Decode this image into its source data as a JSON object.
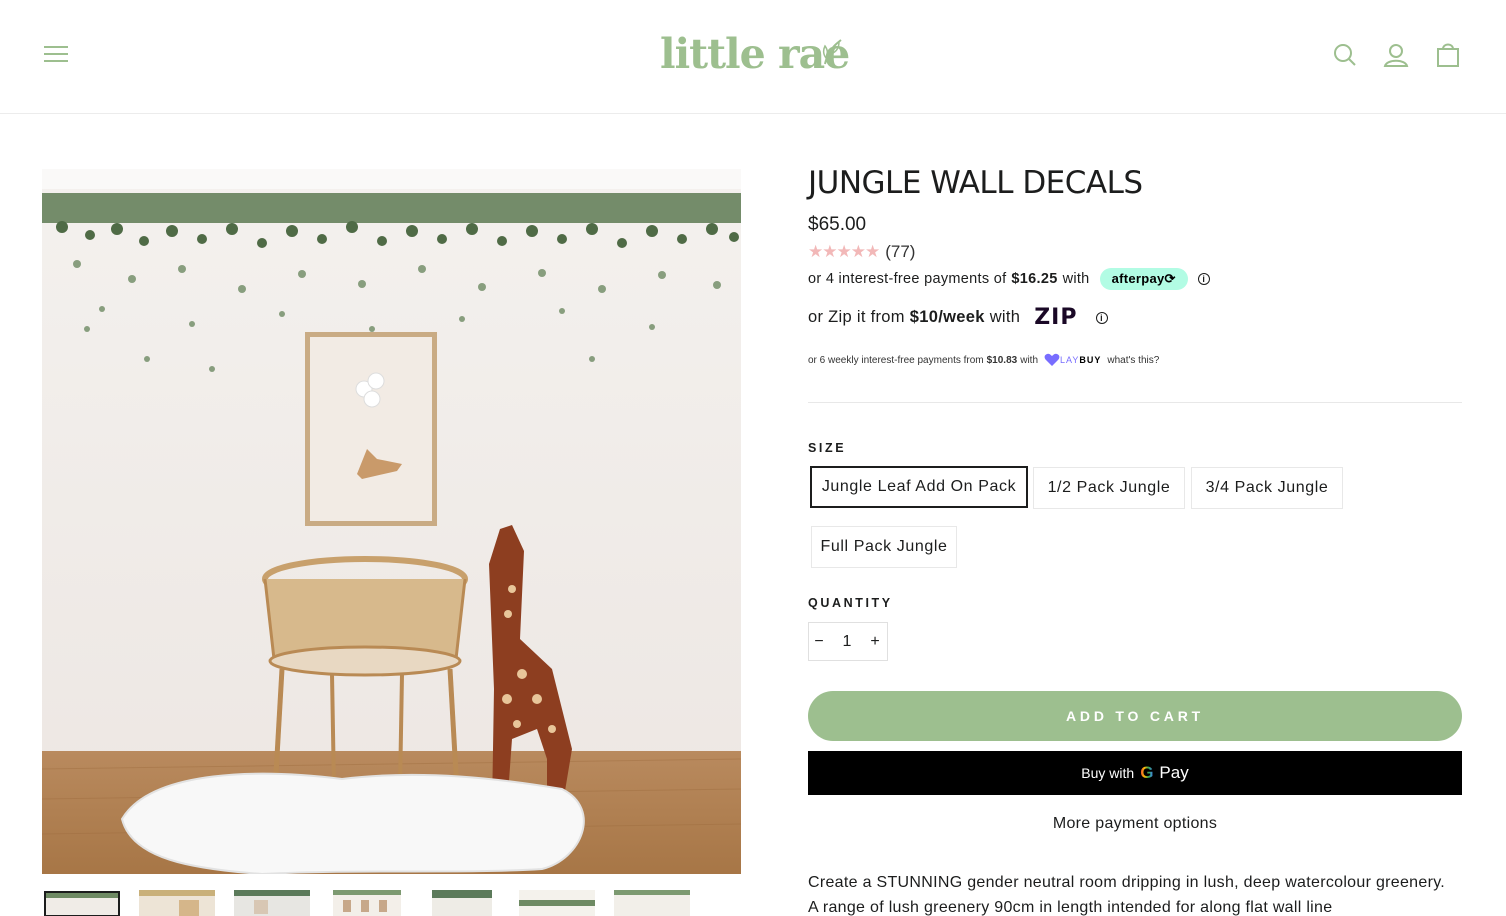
{
  "header": {
    "logo_text": "little rae",
    "menu_icon": "hamburger-icon",
    "search_icon": "search-icon",
    "account_icon": "account-icon",
    "cart_icon": "cart-icon",
    "brand_color": "#9dbf8f"
  },
  "product": {
    "title": "JUNGLE WALL DECALS",
    "price": "$65.00",
    "rating_count": "(77)",
    "rating_stars": 5,
    "afterpay": {
      "prefix": "or 4 interest-free payments of",
      "amount": "$16.25",
      "suffix": "with",
      "badge": "afterpay⟳",
      "info": "i"
    },
    "zip": {
      "prefix": "or Zip it from",
      "amount": "$10/week",
      "suffix": "with",
      "logo": "ZIP",
      "info": "i"
    },
    "laybuy": {
      "prefix": "or 6 weekly interest-free payments from",
      "amount": "$10.83",
      "suffix": "with",
      "logo_light": "LAY",
      "logo_bold": "BUY",
      "link": "what's this?"
    }
  },
  "size": {
    "label": "SIZE",
    "options": [
      "Jungle Leaf Add On Pack",
      "1/2 Pack Jungle",
      "3/4 Pack Jungle",
      "Full Pack Jungle"
    ],
    "selected": "Jungle Leaf Add On Pack"
  },
  "quantity": {
    "label": "QUANTITY",
    "value": "1",
    "minus": "−",
    "plus": "+"
  },
  "actions": {
    "add_to_cart": "ADD TO CART",
    "gpay_prefix": "Buy with",
    "gpay_g": "G",
    "gpay_pay": "Pay",
    "more_payment": "More payment options"
  },
  "description": "Create a STUNNING gender neutral room dripping in lush, deep watercolour greenery. A range of lush greenery 90cm in length intended for along flat wall line",
  "gallery": {
    "thumbnail_count": 7,
    "active_thumbnail": 0
  }
}
